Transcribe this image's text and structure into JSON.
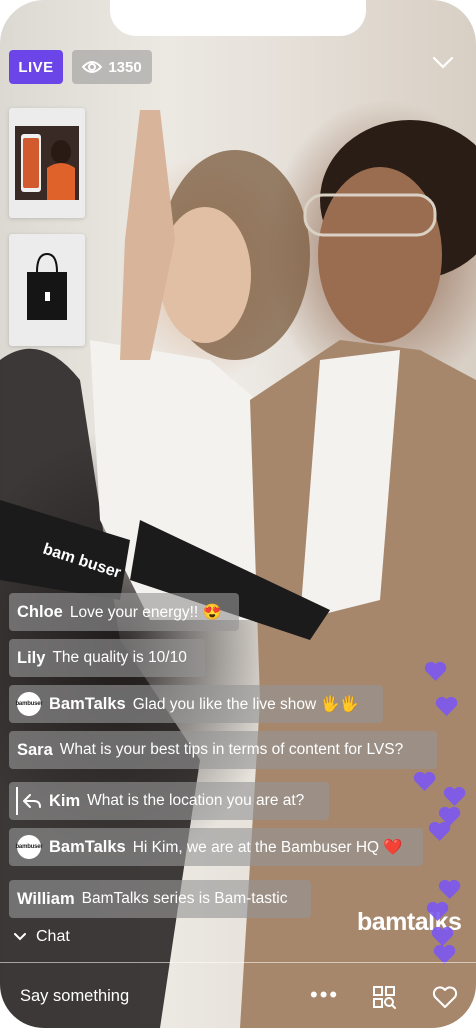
{
  "stream": {
    "live_label": "LIVE",
    "viewer_count": "1350"
  },
  "products": [
    {
      "name": "phone-product",
      "icon": "phone-image"
    },
    {
      "name": "tote-bag-product",
      "icon": "tote-bag-image"
    }
  ],
  "chat": {
    "messages": [
      {
        "name": "Chloe",
        "text": "Love your energy!! 😍"
      },
      {
        "name": "Lily",
        "text": "The quality is 10/10"
      },
      {
        "name": "BamTalks",
        "text": "Glad you like the live show 🖐️🖐️",
        "avatar": "bambuser"
      },
      {
        "name": "Sara",
        "text": "What is your best tips in terms of content for LVS?"
      },
      {
        "name": "Kim",
        "text": "What is the location you are at?",
        "reply": true
      },
      {
        "name": "BamTalks",
        "text": "Hi Kim, we are at the Bambuser HQ ❤️",
        "avatar": "bambuser"
      },
      {
        "name": "William",
        "text": "BamTalks series is Bam-tastic"
      }
    ],
    "toggle_label": "Chat"
  },
  "brand": {
    "logo_text": "bamtalks"
  },
  "input": {
    "placeholder": "Say something"
  },
  "colors": {
    "accent": "#6c45e9",
    "heart": "#7b58f0",
    "chat_bubble": "rgba(150,150,150,0.62)"
  }
}
